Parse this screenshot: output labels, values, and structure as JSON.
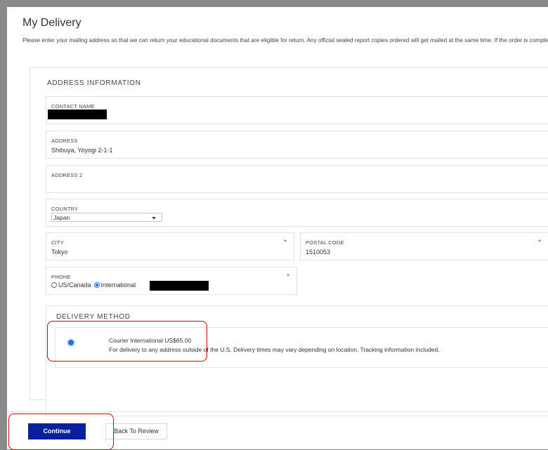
{
  "page": {
    "title": "My Delivery",
    "intro": "Please enter your mailing address so that we can return your educational documents that are eligible for return. Any official sealed report copies ordered will get mailed at the same time. If the order is complete."
  },
  "address_section": {
    "heading": "ADDRESS INFORMATION",
    "contact_name": {
      "label": "CONTACT NAME",
      "value": ""
    },
    "address": {
      "label": "ADDRESS",
      "value": "Shibuya, Yoyogi 2-1-1"
    },
    "address2": {
      "label": "ADDRESS 2",
      "value": ""
    },
    "country": {
      "label": "COUNTRY",
      "selected": "Japan"
    },
    "city": {
      "label": "CITY",
      "value": "Tokyo",
      "required_mark": "*"
    },
    "postal_code": {
      "label": "POSTAL CODE",
      "value": "1510053",
      "required_mark": "*"
    },
    "phone": {
      "label": "PHONE",
      "required_mark": "*",
      "options": [
        "US/Canada",
        "International"
      ],
      "selected": "International"
    }
  },
  "delivery_section": {
    "heading": "DELIVERY METHOD",
    "method_name": "Courier International US$65.00",
    "method_desc": "For delivery to any address outside of the U.S. Delivery times may vary depending on location. Tracking information included."
  },
  "footer": {
    "continue_label": "Continue",
    "back_label": "Back To Review"
  },
  "colors": {
    "accent": "#0a1f9e",
    "radio": "#1a73e8",
    "highlight": "#d60000",
    "required": "#d32f2f"
  }
}
